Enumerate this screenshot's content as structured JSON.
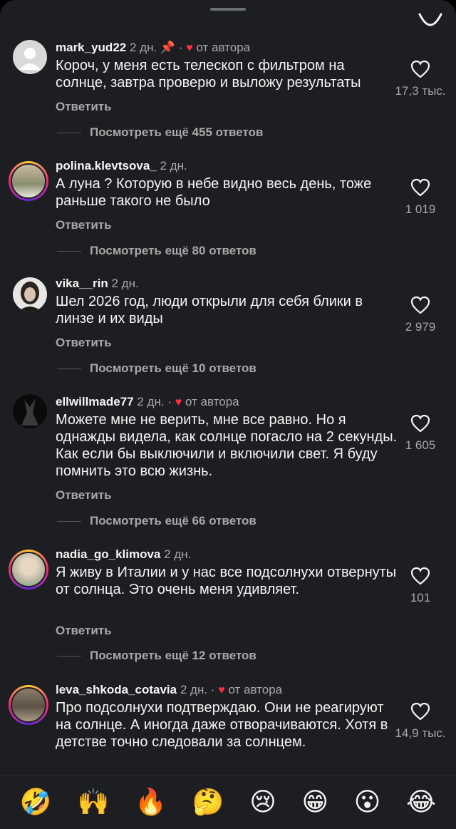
{
  "emoji_bar": [
    "🤣",
    "🙌",
    "🔥",
    "🤔",
    "😢",
    "😁",
    "😮",
    "😂"
  ],
  "comments": [
    {
      "user": "mark_yud22",
      "time": "2 дн.",
      "pinned": true,
      "author_liked": "от автора",
      "text": "Короч, у меня есть телескоп с фильтром на солнце, завтра проверю и выложу результаты",
      "reply": "Ответить",
      "likes": "17,3 тыс.",
      "more": "Посмотреть ещё 455 ответов"
    },
    {
      "user": "polina.klevtsova_",
      "time": "2 дн.",
      "text": "А луна ? Которую в небе видно весь день, тоже раньше такого не было",
      "reply": "Ответить",
      "likes": "1 019",
      "more": "Посмотреть ещё 80 ответов"
    },
    {
      "user": "vika__rin",
      "time": "2 дн.",
      "text": "Шел 2026 год, люди открыли для себя блики в линзе и их виды",
      "reply": "Ответить",
      "likes": "2 979",
      "more": "Посмотреть ещё 10 ответов"
    },
    {
      "user": "ellwillmade77",
      "time": "2 дн.",
      "author_liked": "от автора",
      "text": "Можете мне не верить, мне все равно. Но я однажды видела, как солнце погасло на 2 секунды. Как если бы выключили и включили свет. Я буду помнить это всю жизнь.",
      "reply": "Ответить",
      "likes": "1 605",
      "more": "Посмотреть ещё 66 ответов"
    },
    {
      "user": "nadia_go_klimova",
      "time": "2 дн.",
      "text": "Я живу в Италии и у нас все подсолнухи отвернуты от солнца. Это очень меня удивляет.",
      "reply": "Ответить",
      "likes": "101",
      "more": "Посмотреть ещё 12 ответов"
    },
    {
      "user": "leva_shkoda_cotavia",
      "time": "2 дн.",
      "author_liked": "от автора",
      "text": "Про подсолнухи подтверждаю. Они не реагируют на солнце. А иногда даже отворачиваются. Хотя в детстве точно следовали за солнцем.",
      "likes": "14,9 тыс."
    }
  ]
}
